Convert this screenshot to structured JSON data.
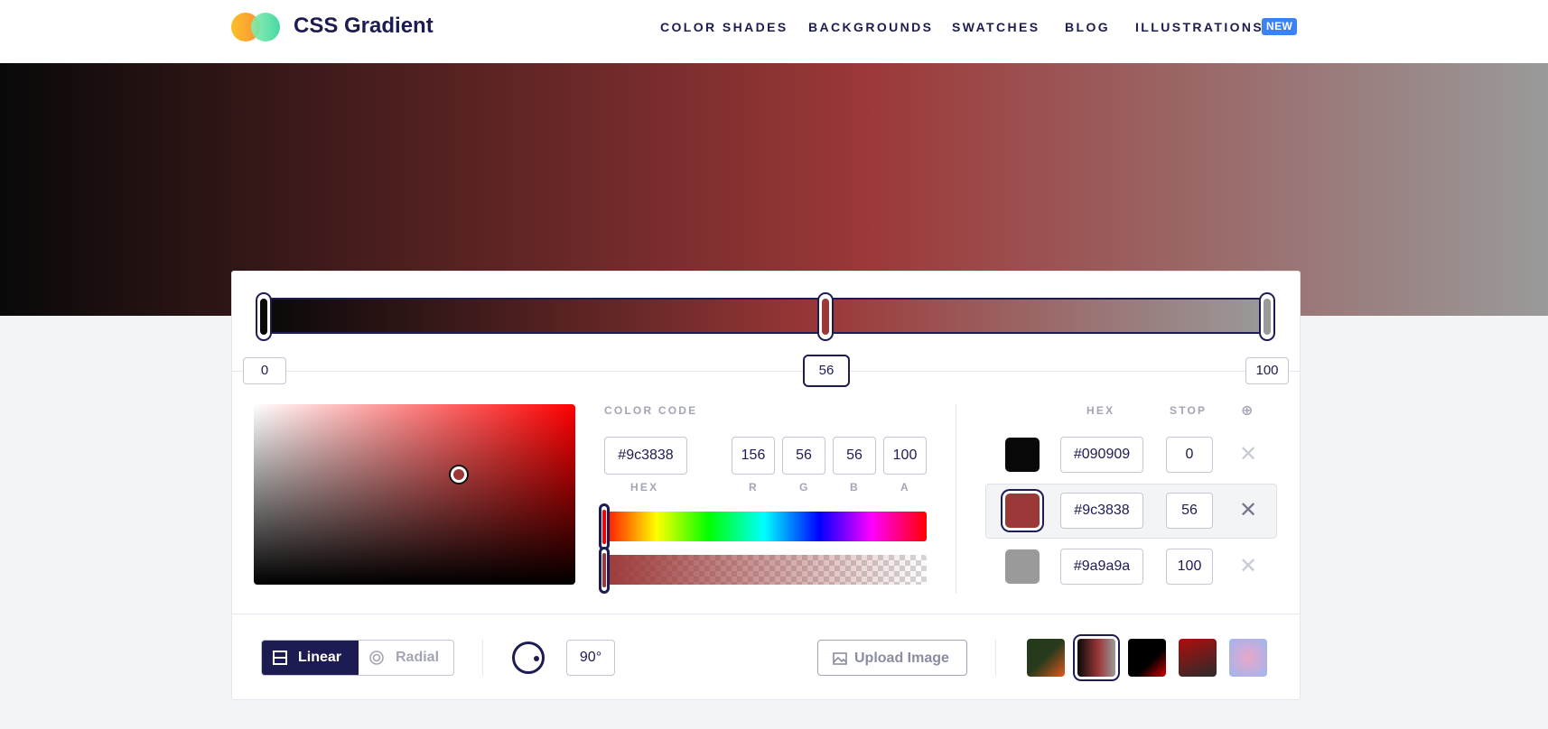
{
  "brand": {
    "name": "CSS Gradient"
  },
  "nav": {
    "links": [
      "COLOR SHADES",
      "BACKGROUNDS",
      "SWATCHES",
      "BLOG",
      "ILLUSTRATIONS"
    ],
    "new_badge": "NEW"
  },
  "gradient": {
    "type": "linear",
    "angle": "90°",
    "stops": [
      {
        "hex": "#090909",
        "stop": "0"
      },
      {
        "hex": "#9c3838",
        "stop": "56"
      },
      {
        "hex": "#9a9a9a",
        "stop": "100"
      }
    ]
  },
  "editor": {
    "color_code_label": "COLOR CODE",
    "hex_value": "#9c3838",
    "r": "156",
    "g": "56",
    "b": "56",
    "a": "100",
    "labels": {
      "hex": "HEX",
      "r": "R",
      "g": "G",
      "b": "B",
      "a": "A"
    }
  },
  "stops_table": {
    "hex_header": "HEX",
    "stop_header": "STOP",
    "add_icon": "⊕",
    "remove_icon": "✕",
    "rows": [
      {
        "hex": "#090909",
        "stop": "0"
      },
      {
        "hex": "#9c3838",
        "stop": "56"
      },
      {
        "hex": "#9a9a9a",
        "stop": "100"
      }
    ]
  },
  "toolbar": {
    "linear_label": "Linear",
    "radial_label": "Radial",
    "angle_value": "90°",
    "upload_label": "Upload Image"
  },
  "presets": [
    {
      "from": "#1f3a1a",
      "to": "#e05a1a"
    },
    {
      "from": "#090909",
      "to": "#9a9a9a"
    },
    {
      "from": "#000000",
      "to": "#d10000"
    },
    {
      "from": "#b00d0d",
      "to": "#2b2b2b"
    },
    {
      "from": "#e9a6c9",
      "to": "#9cb7f0"
    }
  ],
  "colors": {
    "primary": "#1c1c52",
    "accent_new": "#3b82f6",
    "stop_active": "#9c3838"
  }
}
